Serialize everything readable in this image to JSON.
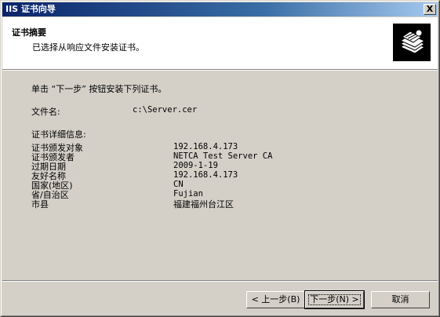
{
  "window": {
    "title": "IIS 证书向导",
    "close_glyph": "X"
  },
  "header": {
    "title": "证书摘要",
    "subtitle": "已选择从响应文件安装证书。",
    "icon": "certificate-stack-icon"
  },
  "body": {
    "instruction": "单击 “下一步” 按钮安装下列证书。",
    "filename_label": "文件名:",
    "filename_value": "c:\\Server.cer",
    "details_heading": "证书详细信息:",
    "details": [
      {
        "label": "证书颁发对象",
        "value": "192.168.4.173"
      },
      {
        "label": "证书颁发者",
        "value": "NETCA Test Server CA"
      },
      {
        "label": "过期日期",
        "value": "2009-1-19"
      },
      {
        "label": "友好名称",
        "value": "192.168.4.173"
      },
      {
        "label": "国家(地区)",
        "value": "CN"
      },
      {
        "label": "省/自治区",
        "value": "Fujian"
      },
      {
        "label": "市县",
        "value": "福建福州台江区"
      }
    ]
  },
  "buttons": {
    "back": "< 上一步(B)",
    "next": "下一步(N) >",
    "cancel": "取消"
  }
}
